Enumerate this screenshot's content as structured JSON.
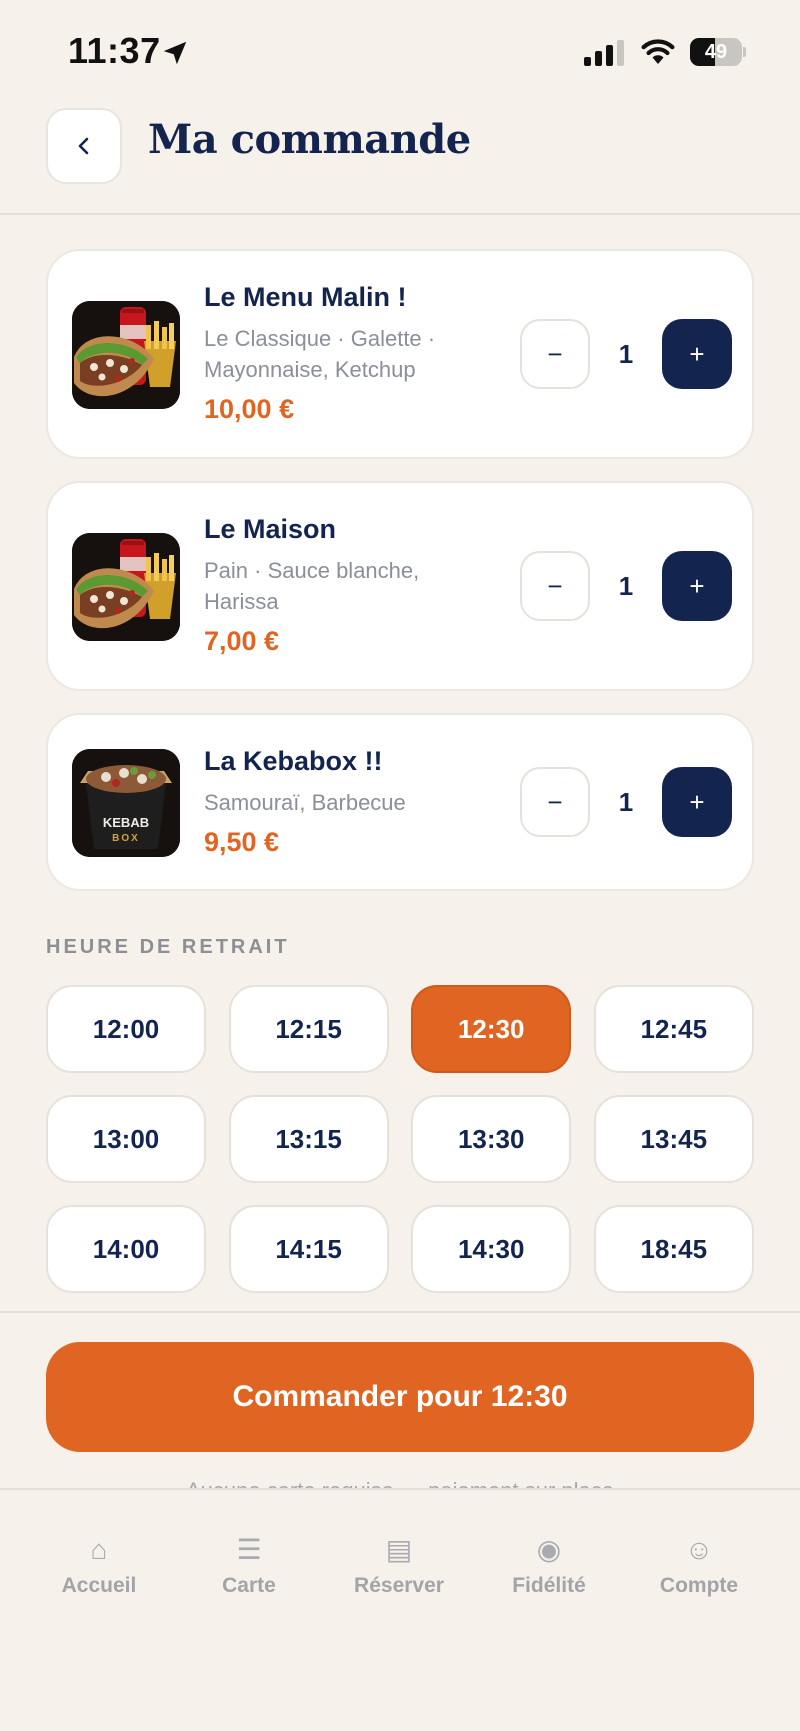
{
  "status_bar": {
    "time": "11:37",
    "battery": "49",
    "battery_level": 49
  },
  "header": {
    "title": "Ma commande"
  },
  "order_items": [
    {
      "name": "Le Menu Malin !",
      "description": "Le Classique · Galette · Mayonnaise, Ketchup",
      "price": "10,00 €",
      "quantity": "1",
      "image": "kebab-menu-with-cola-and-fries"
    },
    {
      "name": "Le Maison",
      "description": "Pain · Sauce blanche, Harissa",
      "price": "7,00 €",
      "quantity": "1",
      "image": "kebab-menu-with-cola-and-fries"
    },
    {
      "name": "La Kebabox !!",
      "description": "Samouraï, Barbecue",
      "price": "9,50 €",
      "quantity": "1",
      "image": "kebab-box",
      "box_label_line1": "KEBAB",
      "box_label_line2": "BOX"
    }
  ],
  "pickup": {
    "label": "HEURE DE RETRAIT",
    "selected": "12:30",
    "slots": [
      "12:00",
      "12:15",
      "12:30",
      "12:45",
      "13:00",
      "13:15",
      "13:30",
      "13:45",
      "14:00",
      "14:15",
      "14:30",
      "18:45"
    ]
  },
  "checkout": {
    "button_label": "Commander pour 12:30",
    "note": "Aucune carte requise — paiement sur place"
  },
  "tab_bar": {
    "items": [
      {
        "label": "Accueil",
        "icon": "home-icon",
        "glyph": "⌂"
      },
      {
        "label": "Carte",
        "icon": "menu-icon",
        "glyph": "☰"
      },
      {
        "label": "Réserver",
        "icon": "calendar-icon",
        "glyph": "▤"
      },
      {
        "label": "Fidélité",
        "icon": "loyalty-icon",
        "glyph": "◉"
      },
      {
        "label": "Compte",
        "icon": "account-icon",
        "glyph": "☺"
      }
    ]
  },
  "colors": {
    "background": "#f6f1ea",
    "navy": "#13244e",
    "accent_orange": "#e06522",
    "muted_text": "#8a8f99"
  }
}
